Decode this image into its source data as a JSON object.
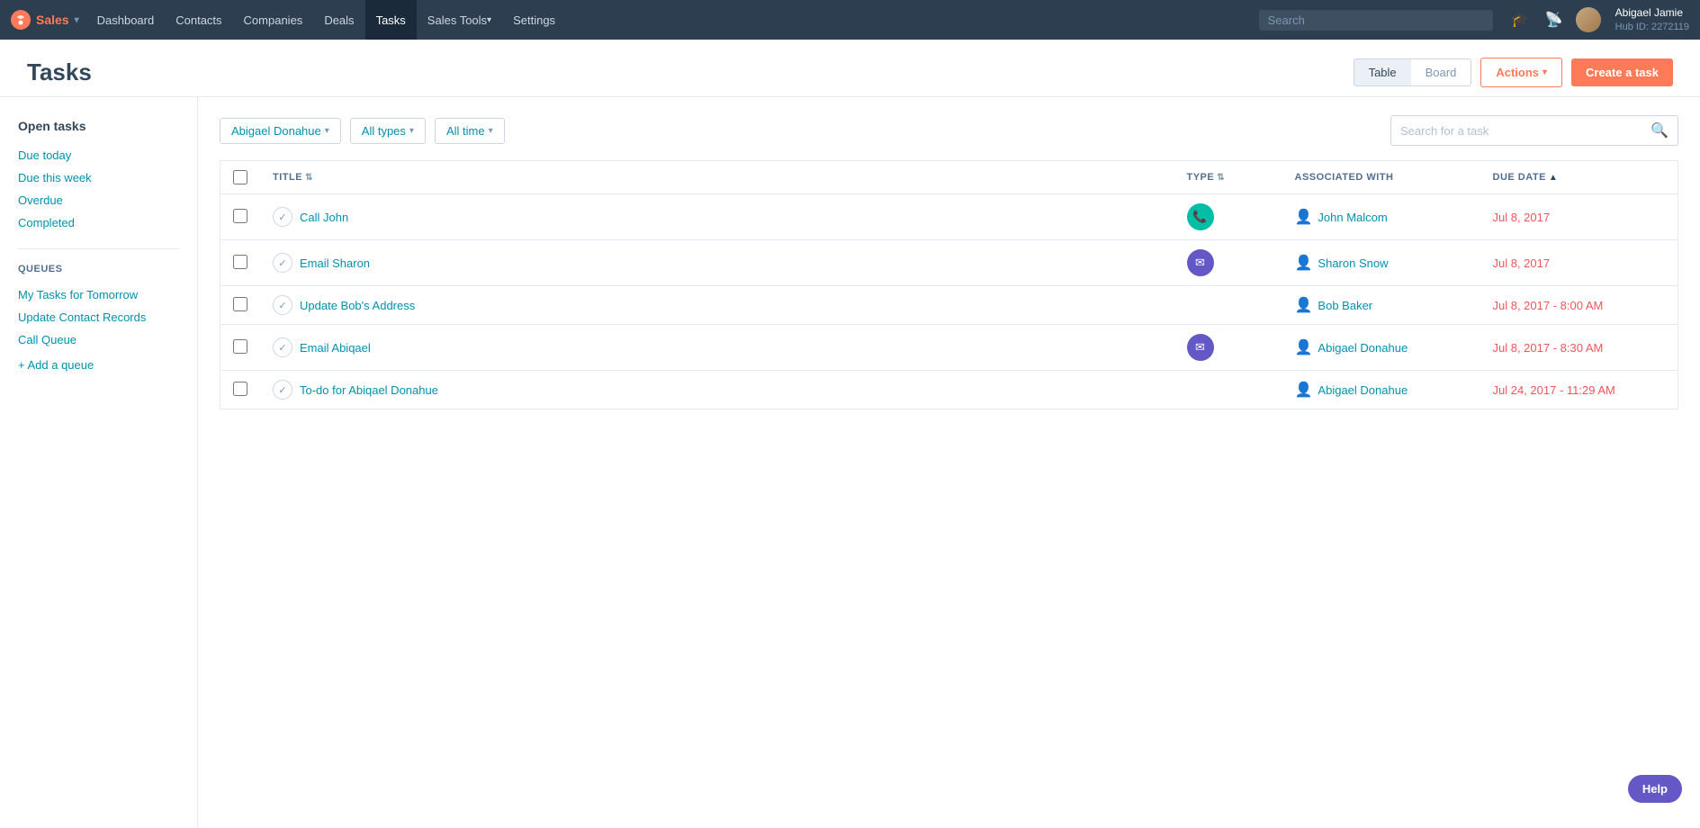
{
  "nav": {
    "brand": "Sales",
    "items": [
      {
        "label": "Dashboard",
        "active": false,
        "hasArrow": false
      },
      {
        "label": "Contacts",
        "active": false,
        "hasArrow": false
      },
      {
        "label": "Companies",
        "active": false,
        "hasArrow": false
      },
      {
        "label": "Deals",
        "active": false,
        "hasArrow": false
      },
      {
        "label": "Tasks",
        "active": true,
        "hasArrow": false
      },
      {
        "label": "Sales Tools",
        "active": false,
        "hasArrow": true
      },
      {
        "label": "Settings",
        "active": false,
        "hasArrow": false
      }
    ],
    "search_placeholder": "Search",
    "user_name": "Abigael Jamie",
    "hub_id": "Hub ID: 2272119"
  },
  "page": {
    "title": "Tasks",
    "view_table_label": "Table",
    "view_board_label": "Board",
    "actions_label": "Actions",
    "create_label": "Create a task"
  },
  "sidebar": {
    "open_tasks_label": "Open tasks",
    "filters": [
      {
        "label": "Due today"
      },
      {
        "label": "Due this week"
      },
      {
        "label": "Overdue"
      },
      {
        "label": "Completed"
      }
    ],
    "queues_title": "Queues",
    "queue_items": [
      {
        "label": "My Tasks for Tomorrow"
      },
      {
        "label": "Update Contact Records"
      },
      {
        "label": "Call Queue"
      }
    ],
    "add_queue_label": "+ Add a queue"
  },
  "filters": {
    "assignee": "Abigael Donahue",
    "type": "All types",
    "time": "All time",
    "search_placeholder": "Search for a task"
  },
  "table": {
    "columns": [
      {
        "key": "title",
        "label": "Title",
        "sortable": true,
        "sort_dir": "none"
      },
      {
        "key": "type",
        "label": "Type",
        "sortable": true,
        "sort_dir": "none"
      },
      {
        "key": "associated_with",
        "label": "Associated With",
        "sortable": false
      },
      {
        "key": "due_date",
        "label": "Due Date",
        "sortable": true,
        "sort_dir": "up"
      }
    ],
    "rows": [
      {
        "id": 1,
        "title": "Call John",
        "type": "call",
        "type_icon": "📞",
        "associated_name": "John Malcom",
        "due_date": "Jul 8, 2017",
        "overdue": true
      },
      {
        "id": 2,
        "title": "Email Sharon",
        "type": "email",
        "type_icon": "✉",
        "associated_name": "Sharon Snow",
        "due_date": "Jul 8, 2017",
        "overdue": true
      },
      {
        "id": 3,
        "title": "Update Bob's Address",
        "type": "none",
        "type_icon": "",
        "associated_name": "Bob Baker",
        "due_date": "Jul 8, 2017 - 8:00 AM",
        "overdue": true
      },
      {
        "id": 4,
        "title": "Email Abiqael",
        "type": "email",
        "type_icon": "✉",
        "associated_name": "Abigael Donahue",
        "due_date": "Jul 8, 2017 - 8:30 AM",
        "overdue": true
      },
      {
        "id": 5,
        "title": "To-do for Abiqael Donahue",
        "type": "none",
        "type_icon": "",
        "associated_name": "Abigael Donahue",
        "due_date": "Jul 24, 2017 - 11:29 AM",
        "overdue": true
      }
    ]
  },
  "help_label": "Help"
}
